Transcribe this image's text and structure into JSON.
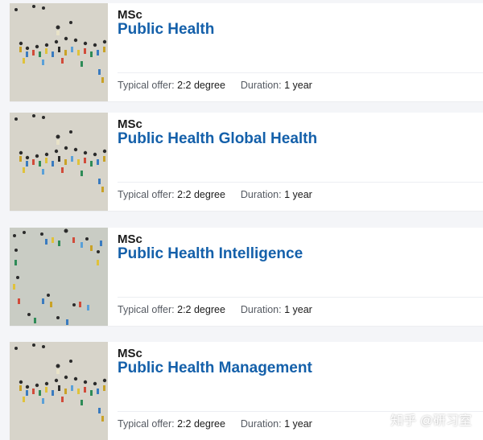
{
  "courses": [
    {
      "level": "MSc",
      "title": "Public Health",
      "offer_label": "Typical offer:",
      "offer_value": "2:2 degree",
      "duration_label": "Duration:",
      "duration_value": "1 year",
      "image_icon": "crowd-aerial-photo"
    },
    {
      "level": "MSc",
      "title": "Public Health Global Health",
      "offer_label": "Typical offer:",
      "offer_value": "2:2 degree",
      "duration_label": "Duration:",
      "duration_value": "1 year",
      "image_icon": "crowd-aerial-photo"
    },
    {
      "level": "MSc",
      "title": "Public Health Intelligence",
      "offer_label": "Typical offer:",
      "offer_value": "2:2 degree",
      "duration_label": "Duration:",
      "duration_value": "1 year",
      "image_icon": "crowd-aerial-photo"
    },
    {
      "level": "MSc",
      "title": "Public Health Management",
      "offer_label": "Typical offer:",
      "offer_value": "2:2 degree",
      "duration_label": "Duration:",
      "duration_value": "1 year",
      "image_icon": "crowd-aerial-photo"
    }
  ],
  "watermark": "知乎 @研习室",
  "colors": {
    "title_blue": "#1460aa",
    "page_bg": "#f4f5f8",
    "card_bg": "#ffffff"
  }
}
